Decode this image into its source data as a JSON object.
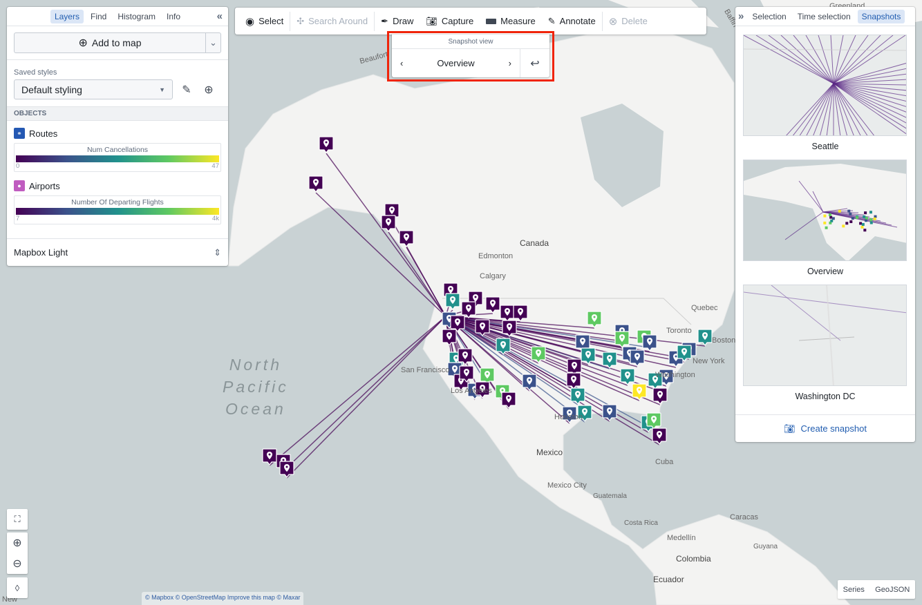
{
  "map": {
    "labels": {
      "beaufort": "Beaufort",
      "baffin": "Baffin Bay",
      "greenland": "Greenland",
      "canada": "Canada",
      "edmonton": "Edmonton",
      "calgary": "Calgary",
      "quebec": "Quebec",
      "toronto": "Toronto",
      "boston": "Boston",
      "new_york": "New York",
      "washington": "Washington",
      "san_francisco": "San Francisco",
      "los_angeles": "Los Angeles",
      "houston": "Houston",
      "mexico": "Mexico",
      "mexico_city": "Mexico City",
      "guatemala": "Guatemala",
      "cuba": "Cuba",
      "caracas": "Caracas",
      "costa_rica": "Costa Rica",
      "medellin": "Medellín",
      "colombia": "Colombia",
      "guyana": "Guyana",
      "ecuador": "Ecuador",
      "new": "New",
      "ocean_l1": "North",
      "ocean_l2": "Pacific",
      "ocean_l3": "Ocean"
    },
    "attribution": "© Mapbox © OpenStreetMap Improve this map © Maxar",
    "export_buttons": [
      "Series",
      "GeoJSON"
    ]
  },
  "left_panel": {
    "tabs": [
      {
        "label": "Layers",
        "active": true
      },
      {
        "label": "Find"
      },
      {
        "label": "Histogram"
      },
      {
        "label": "Info"
      }
    ],
    "add_to_map": "Add to map",
    "saved_styles_label": "Saved styles",
    "saved_style_value": "Default styling",
    "objects_header": "OBJECTS",
    "layers": [
      {
        "name": "Routes",
        "icon": "route-icon",
        "icon_color": "#2458b3",
        "legend_title": "Num Cancellations",
        "min": "0",
        "max": "47"
      },
      {
        "name": "Airports",
        "icon": "map-marker-icon",
        "icon_color": "#c05cc0",
        "legend_title": "Number Of Departing Flights",
        "min": "7",
        "max": "4k"
      }
    ],
    "basemap": "Mapbox Light"
  },
  "toolbar": {
    "items": [
      {
        "label": "Select",
        "icon": "select-icon",
        "disabled": false
      },
      {
        "label": "Search Around",
        "icon": "graph-icon",
        "disabled": true
      },
      {
        "label": "Draw",
        "icon": "pen-icon",
        "disabled": false
      },
      {
        "label": "Capture",
        "icon": "camera-icon",
        "disabled": false
      },
      {
        "label": "Measure",
        "icon": "ruler-icon",
        "disabled": false
      },
      {
        "label": "Annotate",
        "icon": "annotate-icon",
        "disabled": false
      },
      {
        "label": "Delete",
        "icon": "delete-icon",
        "disabled": true
      }
    ]
  },
  "snapshot_view": {
    "title": "Snapshot view",
    "current": "Overview"
  },
  "right_panel": {
    "tabs": [
      {
        "label": "Selection"
      },
      {
        "label": "Time selection"
      },
      {
        "label": "Snapshots",
        "active": true
      }
    ],
    "snapshots": [
      {
        "label": "Seattle"
      },
      {
        "label": "Overview"
      },
      {
        "label": "Washington DC"
      }
    ],
    "create_snapshot": "Create snapshot"
  },
  "colors": {
    "accent": "#215db0",
    "highlight_box": "#f0240a",
    "viridis": [
      "#440154",
      "#3b528b",
      "#21918c",
      "#5ec962",
      "#fde725"
    ]
  }
}
